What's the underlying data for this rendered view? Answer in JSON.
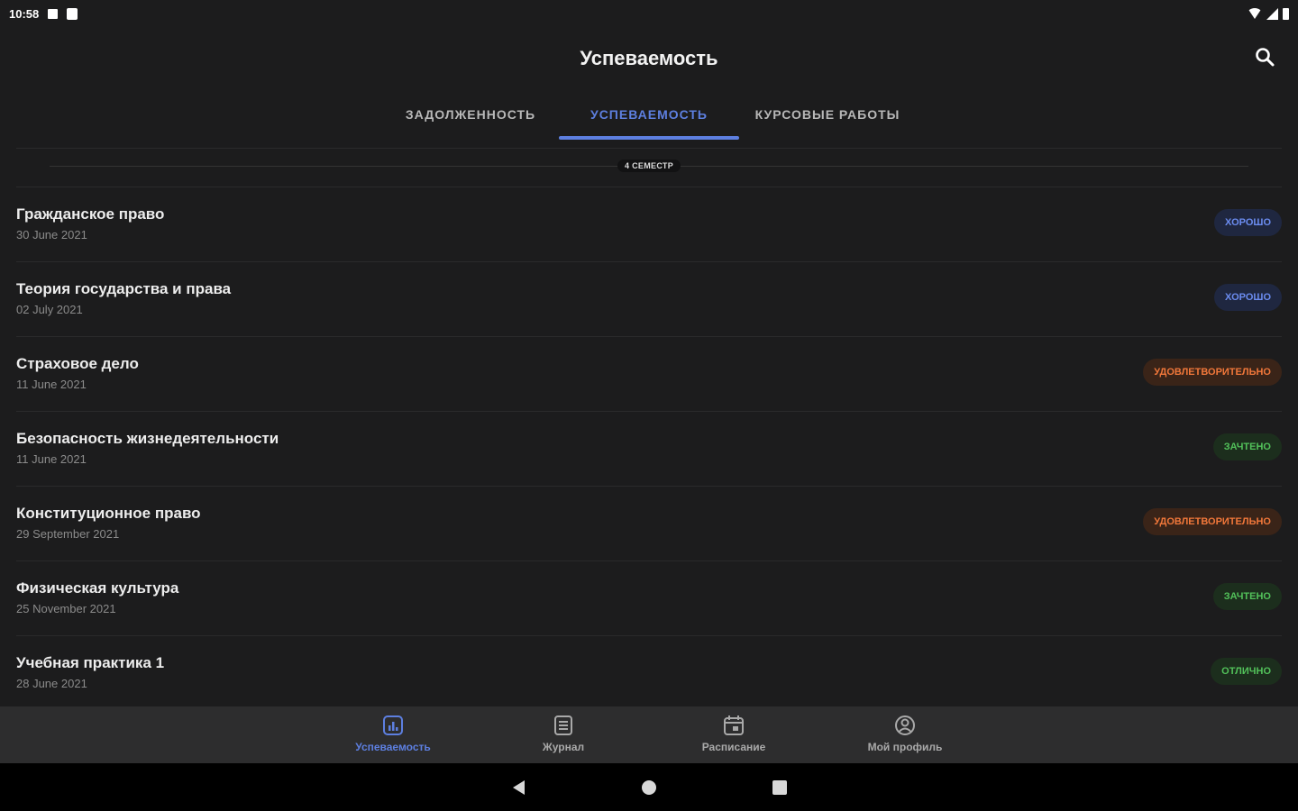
{
  "status_bar": {
    "time": "10:58"
  },
  "header": {
    "title": "Успеваемость",
    "search_icon": "search-icon"
  },
  "tabs": [
    {
      "label": "ЗАДОЛЖЕННОСТЬ",
      "active": false
    },
    {
      "label": "УСПЕВАЕМОСТЬ",
      "active": true
    },
    {
      "label": "КУРСОВЫЕ РАБОТЫ",
      "active": false
    }
  ],
  "semester": {
    "label": "4 СЕМЕСТР"
  },
  "subjects": [
    {
      "name": "Гражданское право",
      "date": "30 June 2021",
      "grade": "ХОРОШО",
      "grade_type": "good"
    },
    {
      "name": "Теория государства и права",
      "date": "02 July 2021",
      "grade": "ХОРОШО",
      "grade_type": "good"
    },
    {
      "name": "Страховое дело",
      "date": "11 June 2021",
      "grade": "УДОВЛЕТВОРИТЕЛЬНО",
      "grade_type": "sat"
    },
    {
      "name": "Безопасность жизнедеятельности",
      "date": "11 June 2021",
      "grade": "ЗАЧТЕНО",
      "grade_type": "pass"
    },
    {
      "name": "Конституционное право",
      "date": "29 September 2021",
      "grade": "УДОВЛЕТВОРИТЕЛЬНО",
      "grade_type": "sat"
    },
    {
      "name": "Физическая культура",
      "date": "25 November 2021",
      "grade": "ЗАЧТЕНО",
      "grade_type": "pass"
    },
    {
      "name": "Учебная практика 1",
      "date": "28 June 2021",
      "grade": "ОТЛИЧНО",
      "grade_type": "excellent"
    }
  ],
  "bottom_nav": [
    {
      "label": "Успеваемость",
      "icon": "chart-icon",
      "active": true
    },
    {
      "label": "Журнал",
      "icon": "journal-icon",
      "active": false
    },
    {
      "label": "Расписание",
      "icon": "calendar-icon",
      "active": false
    },
    {
      "label": "Мой профиль",
      "icon": "profile-icon",
      "active": false
    }
  ],
  "colors": {
    "accent": "#5d7fe0",
    "background": "#1c1c1d",
    "good": "#6b8cf0",
    "satisfactory": "#f0773a",
    "pass": "#52c15a"
  }
}
